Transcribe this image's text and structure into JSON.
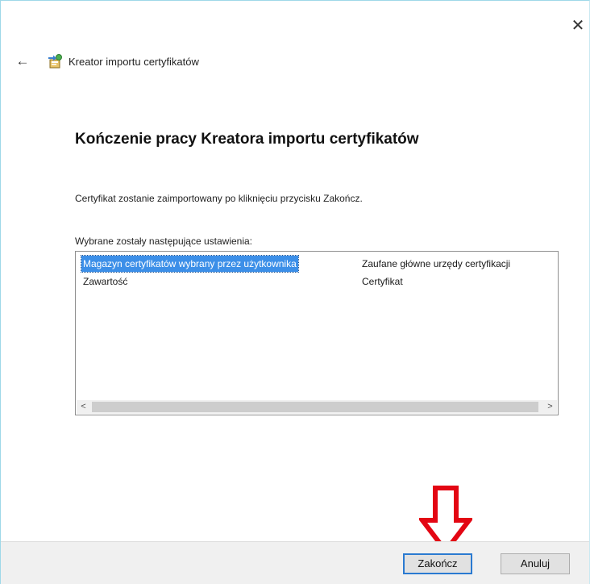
{
  "window": {
    "close_glyph": "✕",
    "back_glyph": "←",
    "title": "Kreator importu certyfikatów"
  },
  "content": {
    "heading": "Kończenie pracy Kreatora importu certyfikatów",
    "intro": "Certyfikat zostanie zaimportowany po kliknięciu przycisku Zakończ.",
    "settings_label": "Wybrane zostały następujące ustawienia:"
  },
  "settings": {
    "rows": [
      {
        "key": "Magazyn certyfikatów wybrany przez użytkownika",
        "value": "Zaufane główne urzędy certyfikacji",
        "selected": true
      },
      {
        "key": "Zawartość",
        "value": "Certyfikat",
        "selected": false
      }
    ],
    "scroll_left_glyph": "<",
    "scroll_right_glyph": ">"
  },
  "buttons": {
    "finish": "Zakończ",
    "cancel": "Anuluj"
  },
  "icons": {
    "wizard": "certificate-import-icon",
    "annotation": "red-down-arrow"
  },
  "colors": {
    "selection": "#3c8fe8",
    "annotation_arrow": "#e30613",
    "default_button_border": "#2a7ad1"
  }
}
